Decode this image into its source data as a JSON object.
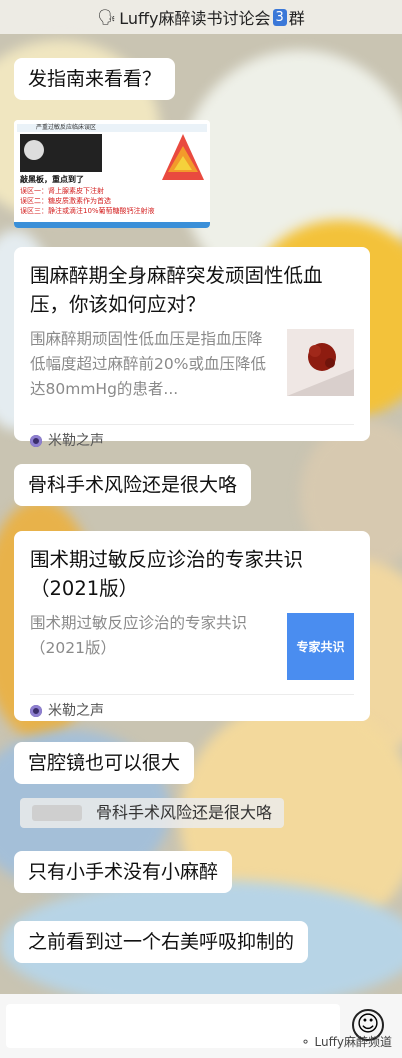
{
  "header": {
    "title_prefix": "Luffy麻醉读书讨论会",
    "group_number": "3",
    "title_suffix": "群"
  },
  "messages": {
    "m1": "发指南来看看？",
    "image": {
      "top_label": "严重过敏反应临床误区",
      "panel_text": "敲黑板，重点到了",
      "items": [
        "误区一：肾上腺素皮下注射",
        "误区二：糖皮质激素作为首选",
        "误区三：静注或滴注10%葡萄糖酸钙注射液"
      ]
    },
    "card1": {
      "title": "围麻醉期全身麻醉突发顽固性低血压，你该如何应对？",
      "desc": "围麻醉期顽固性低血压是指血压降低幅度超过麻醉前20%或血压降低达80mmHg的患者...",
      "source": "米勒之声"
    },
    "m2": "骨科手术风险还是很大咯",
    "card2": {
      "title": "围术期过敏反应诊治的专家共识（2021版）",
      "desc": "围术期过敏反应诊治的专家共识（2021版）",
      "thumb_label": "专家共识",
      "source": "米勒之声"
    },
    "m3": "宫腔镜也可以很大",
    "quote": "骨科手术风险还是很大咯",
    "m4": "只有小手术没有小麻醉",
    "m5": "之前看到过一个右美呼吸抑制的"
  },
  "watermark": "Luffy麻醉频道",
  "colors": {
    "thumb_blue": "#4a8df0",
    "header_badge": "#3b78d8"
  }
}
